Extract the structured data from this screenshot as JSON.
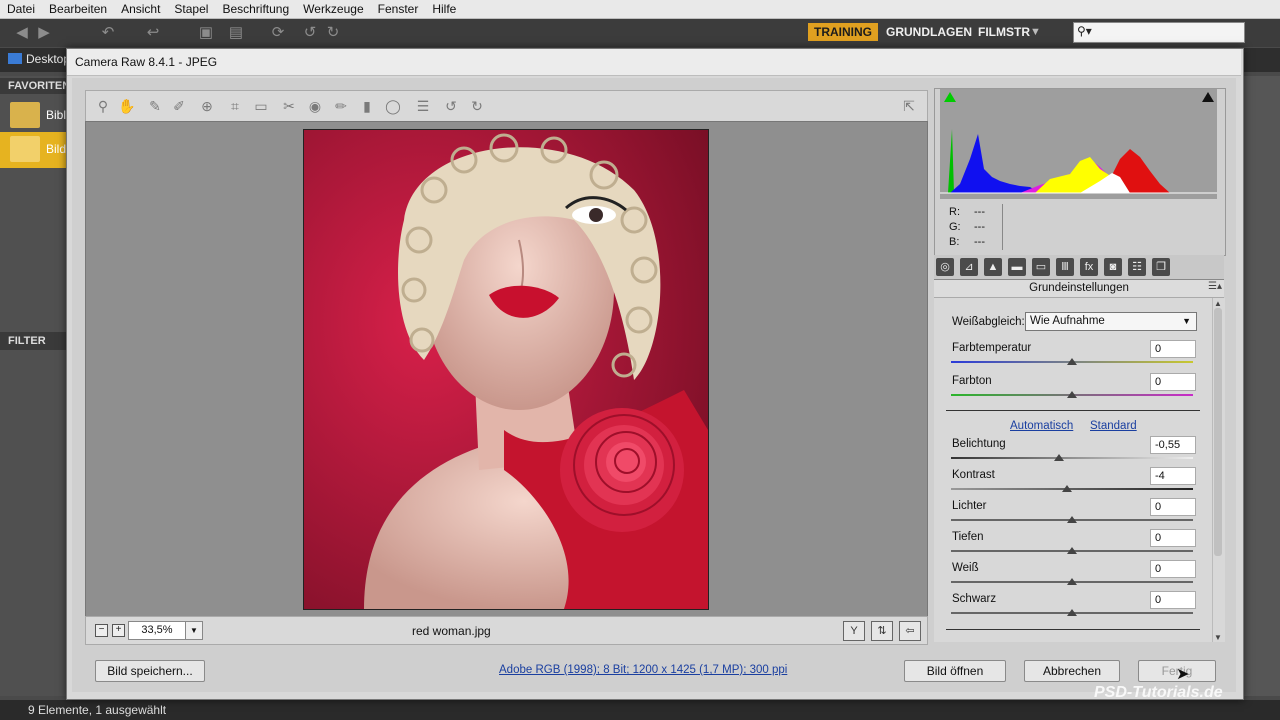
{
  "bridge": {
    "menu": [
      "Datei",
      "Bearbeiten",
      "Ansicht",
      "Stapel",
      "Beschriftung",
      "Werkzeuge",
      "Fenster",
      "Hilfe"
    ],
    "workspaces": {
      "training": "TRAINING",
      "grundlagen": "GRUNDLAGEN",
      "filmstrip": "FILMSTR"
    },
    "path_desktop": "Desktop",
    "favorites_tab": "FAVORITEN",
    "favorites": [
      "Bibl",
      "Bild"
    ],
    "filter_tab": "FILTER",
    "status": "9 Elemente, 1 ausgewählt",
    "search_icon": "search-icon"
  },
  "dialog": {
    "title": "Camera Raw 8.4.1 - JPEG",
    "zoom": "33,5%",
    "filename": "red woman.jpg",
    "rgb": {
      "r_label": "R:",
      "g_label": "G:",
      "b_label": "B:",
      "r": "---",
      "g": "---",
      "b": "---"
    },
    "panel_title": "Grundeinstellungen",
    "wb_label": "Weißabgleich:",
    "wb_value": "Wie Aufnahme",
    "auto_link": "Automatisch",
    "default_link": "Standard",
    "sliders": [
      {
        "label": "Farbtemperatur",
        "value": "0",
        "level": 0.5
      },
      {
        "label": "Farbton",
        "value": "0",
        "level": 0.5
      },
      {
        "label": "Belichtung",
        "value": "-0,55",
        "level": 0.445
      },
      {
        "label": "Kontrast",
        "value": "-4",
        "level": 0.48
      },
      {
        "label": "Lichter",
        "value": "0",
        "level": 0.5
      },
      {
        "label": "Tiefen",
        "value": "0",
        "level": 0.5
      },
      {
        "label": "Weiß",
        "value": "0",
        "level": 0.5
      },
      {
        "label": "Schwarz",
        "value": "0",
        "level": 0.5
      }
    ],
    "save_button": "Bild speichern...",
    "info": "Adobe RGB (1998); 8 Bit; 1200 x 1425 (1,7 MP); 300 ppi",
    "open_button": "Bild öffnen",
    "cancel_button": "Abbrechen",
    "done_button": "Fertig"
  },
  "watermark": "PSD-Tutorials.de",
  "colors": {
    "accent": "#e0a020",
    "link": "#1a3fa0"
  }
}
